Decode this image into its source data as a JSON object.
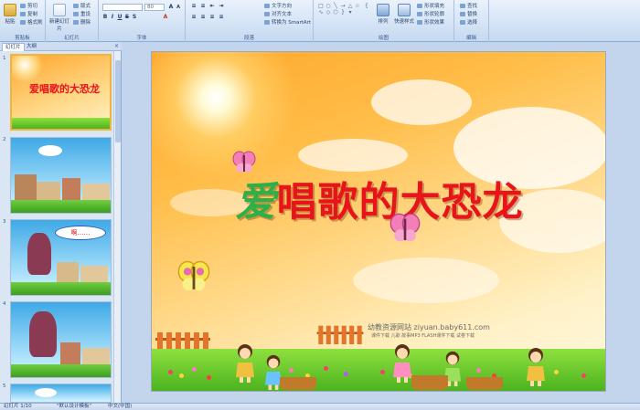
{
  "ribbon": {
    "clipboard": {
      "paste": "粘贴",
      "cut": "剪切",
      "copy": "复制",
      "format_painter": "格式刷",
      "label": "剪贴板"
    },
    "slides": {
      "new_slide": "新建幻灯片",
      "layout": "版式",
      "reset": "重设",
      "delete": "删除",
      "label": "幻灯片"
    },
    "font": {
      "font_name": "",
      "font_size": "80",
      "label": "字体"
    },
    "paragraph": {
      "text_direction": "文字方向",
      "align_text": "对齐文本",
      "smartart": "转换为 SmartArt",
      "label": "段落"
    },
    "drawing": {
      "arrange": "排列",
      "quick_styles": "快速样式",
      "shape_fill": "形状填充",
      "shape_outline": "形状轮廓",
      "shape_effects": "形状效果",
      "label": "绘图"
    },
    "editing": {
      "find": "查找",
      "replace": "替换",
      "select": "选择",
      "label": "编辑"
    }
  },
  "panel": {
    "tab_slides": "幻灯片",
    "tab_outline": "大纲",
    "close": "×",
    "thumbs": [
      {
        "num": "1",
        "title": "爱唱歌的大恐龙",
        "selected": true
      },
      {
        "num": "2",
        "title": "",
        "selected": false
      },
      {
        "num": "3",
        "title": "",
        "bubble": "啊……",
        "selected": false
      },
      {
        "num": "4",
        "title": "",
        "selected": false
      },
      {
        "num": "5",
        "title": "",
        "selected": false
      }
    ]
  },
  "slide": {
    "title_first": "爱",
    "title_rest": "唱歌的大恐龙",
    "watermark_line1": "幼教资源网站  ziyuan.baby611.com",
    "watermark_line2": "课件下载  儿歌  故事MP3  FLASH课件下载  试卷下载"
  },
  "status": {
    "slide_counter": "幻灯片 1/10",
    "theme": "\"默认设计模板\"",
    "language": "中文(中国)"
  },
  "colors": {
    "title_first": "#2bb04a",
    "title_rest": "#e8141c",
    "ribbon_bg": "#d4e3f5",
    "workspace": "#c3d5ec"
  }
}
